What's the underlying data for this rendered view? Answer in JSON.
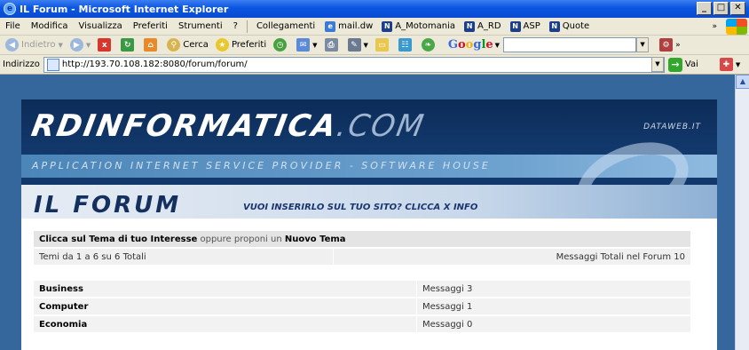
{
  "window": {
    "title": "IL Forum - Microsoft Internet Explorer"
  },
  "menubar": {
    "items": [
      "File",
      "Modifica",
      "Visualizza",
      "Preferiti",
      "Strumenti",
      "?"
    ],
    "links_label": "Collegamenti",
    "links": [
      "mail.dw",
      "A_Motomania",
      "A_RD",
      "ASP",
      "Quote"
    ]
  },
  "toolbar": {
    "back": "Indietro",
    "search": "Cerca",
    "favorites": "Preferiti",
    "google_logo": "Google",
    "google_input_value": ""
  },
  "address": {
    "label": "Indirizzo",
    "url": "http://193.70.108.182:8080/forum/forum/",
    "go": "Vai"
  },
  "banner": {
    "logo_main": "RDINFORMATICA",
    "logo_suffix": ".COM",
    "brand": "DATAWEB.IT",
    "tagline": "APPLICATION INTERNET SERVICE PROVIDER - SOFTWARE HOUSE",
    "forum_title": "IL FORUM",
    "promo": "VUOI INSERIRLO SUL TUO SITO? CLICCA X INFO"
  },
  "forum": {
    "intro_bold_1": "Clicca sul Tema di tuo Interesse",
    "intro_mid": " oppure proponi un ",
    "intro_bold_2": "Nuovo Tema",
    "range_text": "Temi da 1 a 6 su 6  Totali",
    "total_text": "Messaggi Totali nel Forum  10",
    "categories": [
      {
        "name": "Business",
        "messages": "Messaggi 3"
      },
      {
        "name": "Computer",
        "messages": "Messaggi 1"
      },
      {
        "name": "Economia",
        "messages": "Messaggi 0"
      }
    ]
  }
}
